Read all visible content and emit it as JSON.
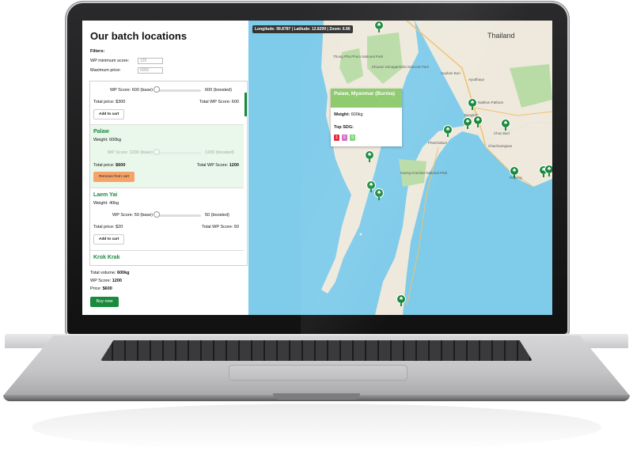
{
  "page": {
    "title": "Our batch locations"
  },
  "filters": {
    "label": "Filters:",
    "min_score_label": "WP minimum score:",
    "min_score_value": "125",
    "max_price_label": "Maximum price:",
    "max_price_value": "6000"
  },
  "batches": [
    {
      "score_base": "600 (base)",
      "score_boosted": "600 (boosted)",
      "total_price": "Total price: $300",
      "total_wp": "Total WP Score: 600",
      "action": "Add to cart"
    },
    {
      "name": "Palaw",
      "weight": "Weight: 600kg",
      "score_base": "WP Score: 1200 (base)",
      "score_boosted": "1200 (boosted)",
      "total_price_label": "Total price:",
      "total_price_value": "$600",
      "total_wp_label": "Total WP Score:",
      "total_wp_value": "1200",
      "action": "Remove from cart"
    },
    {
      "name": "Laem Yai",
      "weight": "Weight: 40kg",
      "score_base": "WP Score: 50 (base)",
      "score_boosted": "50 (boosted)",
      "total_price": "Total price: $20",
      "total_wp": "Total WP Score: 50",
      "action": "Add to cart"
    },
    {
      "name": "Krok Krak"
    }
  ],
  "totals": {
    "volume_label": "Total volume:",
    "volume_value": "600kg",
    "wp_label": "WP Score:",
    "wp_value": "1200",
    "price_label": "Price:",
    "price_value": "$600",
    "buy_label": "Buy now"
  },
  "map": {
    "coords": "Longitude: 99.8787 | Latitude: 12.8209 | Zoom: 6.96",
    "country_label": "Thailand",
    "labels": [
      "Thong Pha Phum National Park",
      "Khuean Srinagarindra National Park",
      "Suphan Buri",
      "Ayutthaya",
      "Bangkok",
      "Chon Buri",
      "Phetchaburi",
      "Kaeng Krachan National Park",
      "Rayong",
      "Chachoengsao",
      "Nakhon Pathom"
    ],
    "popup": {
      "title": "Palaw, Myanmar (Burma)",
      "weight_label": "Weight:",
      "weight_value": "600kg",
      "sdg_label": "Top SDG:",
      "sdgs": [
        "1",
        "5",
        "9"
      ]
    }
  },
  "colors": {
    "accent": "#1a8a3d",
    "selected_bg": "#e9f8ea",
    "remove_btn": "#f6a36a",
    "popup_header": "#8bc96a",
    "water": "#7ecbea",
    "land": "#eee9dc"
  },
  "icons": {
    "map_pin": "tree-pin-icon"
  }
}
